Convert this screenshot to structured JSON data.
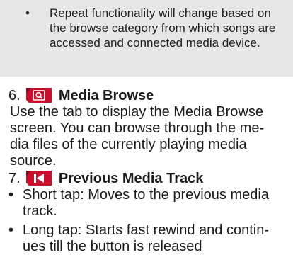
{
  "note": {
    "bullet": "•",
    "text": "Repeat functionality will change based on the browse category from which songs are accessed and connected media device."
  },
  "sections": [
    {
      "number": "6.",
      "title": "Media Browse",
      "icon": "media-browse-icon",
      "body_lines": [
        "Use the tab to display the Media Browse",
        "screen. You can browse through the me-",
        "dia files of the currently playing media",
        "source."
      ]
    },
    {
      "number": "7.",
      "title": "Previous Media Track",
      "icon": "previous-track-icon",
      "bullets": [
        {
          "marker": "•",
          "lines": [
            "Short tap: Moves to the previous media",
            "track."
          ]
        },
        {
          "marker": "•",
          "lines": [
            "Long tap: Starts fast rewind and contin-",
            "ues till the button is released"
          ]
        }
      ]
    }
  ],
  "colors": {
    "note_background": "#e7e7e8",
    "icon_fill": "#c8102e"
  }
}
